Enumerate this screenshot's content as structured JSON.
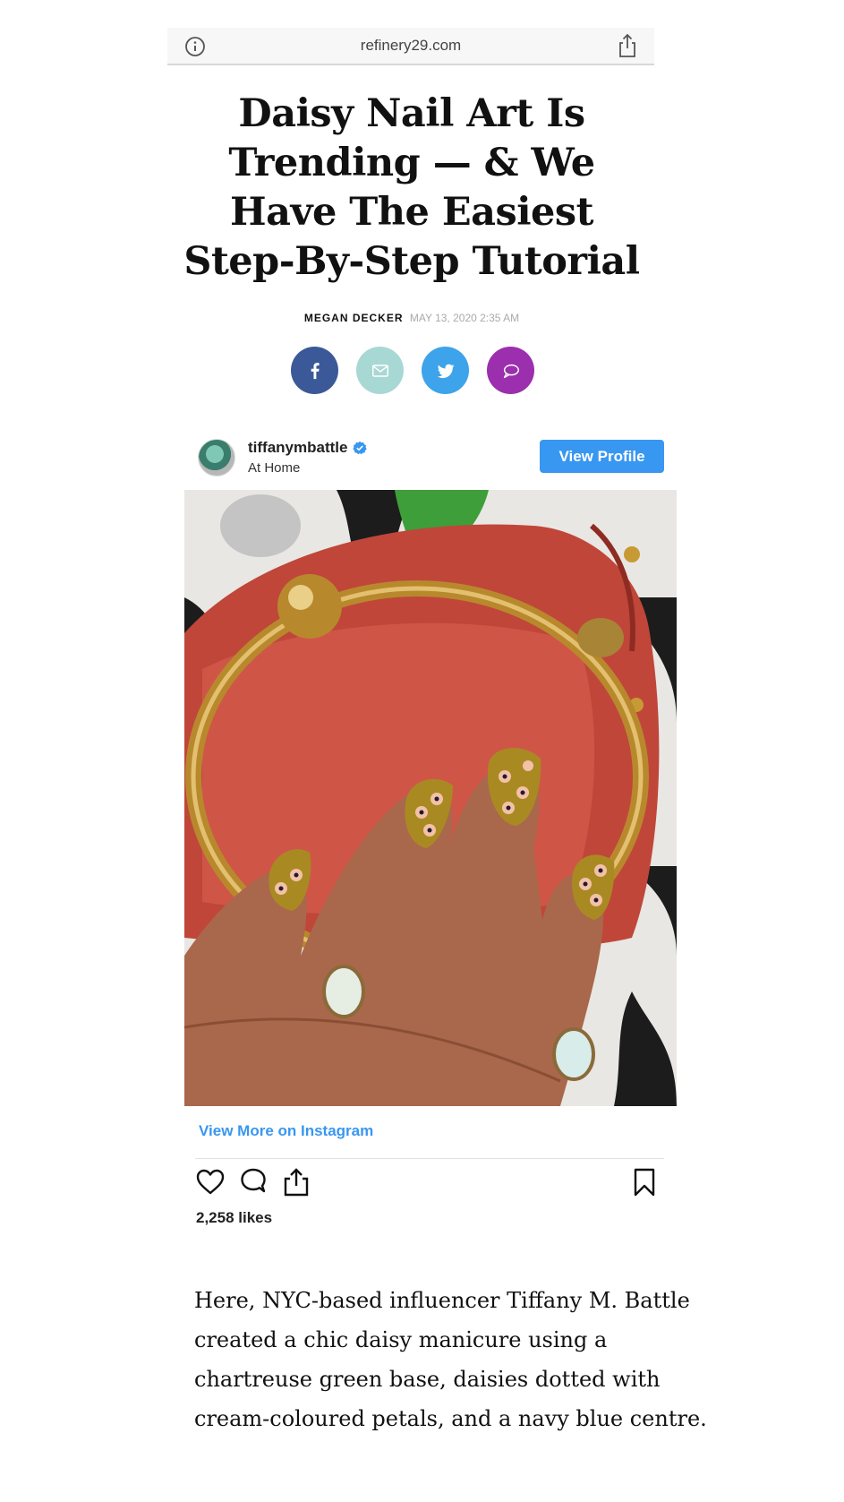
{
  "browser": {
    "url": "refinery29.com"
  },
  "article": {
    "headline": "Daisy Nail Art Is Trending — & We Have The Easiest Step-By-Step Tutorial",
    "author": "MEGAN DECKER",
    "date": "MAY 13, 2020 2:35 AM",
    "share_buttons": [
      {
        "name": "facebook",
        "color": "#3b5998"
      },
      {
        "name": "email",
        "color": "#a8d8d4"
      },
      {
        "name": "twitter",
        "color": "#3da3ea"
      },
      {
        "name": "comment",
        "color": "#9b2fae"
      }
    ],
    "body": "Here, NYC-based influencer Tiffany M. Battle created a chic daisy manicure using a chartreuse green base, daisies dotted with cream-coloured petals, and a navy blue centre."
  },
  "instagram": {
    "username": "tiffanymbattle",
    "location": "At Home",
    "view_profile_label": "View Profile",
    "view_more_label": "View More on Instagram",
    "likes": "2,258 likes",
    "accent_color": "#3897f0"
  }
}
